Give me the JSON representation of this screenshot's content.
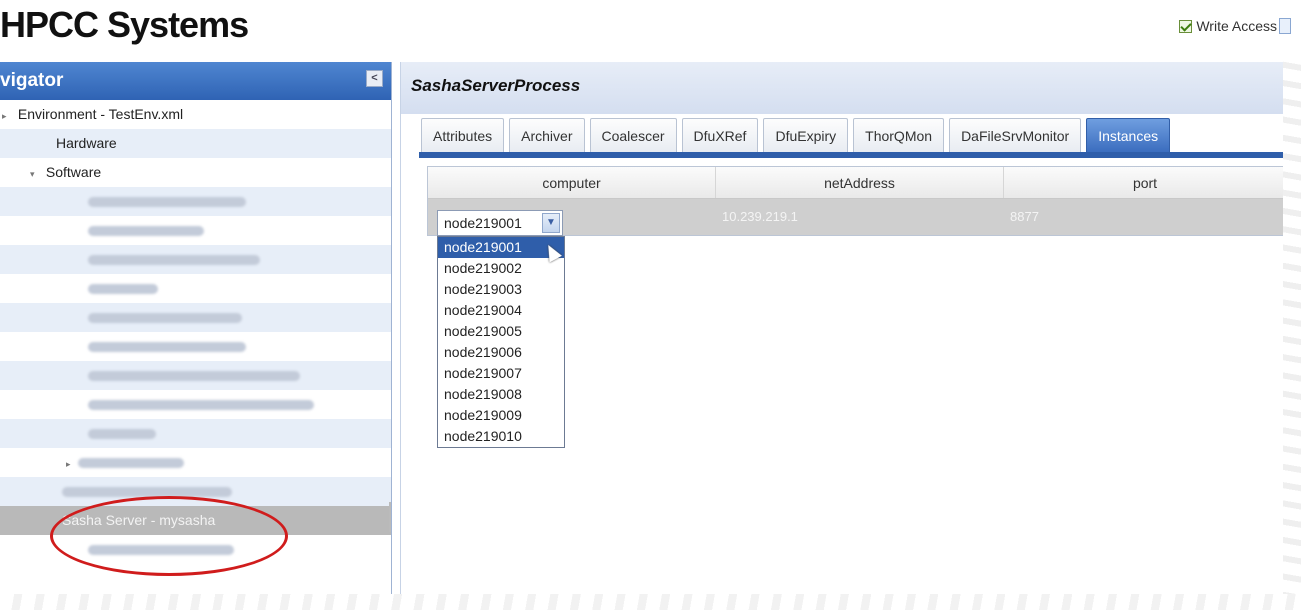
{
  "header": {
    "logo_text": "HPCC Systems",
    "write_access_label": "Write Access"
  },
  "navigator": {
    "title": "vigator",
    "collapse_glyph": "<",
    "items": [
      {
        "label": "Environment - TestEnv.xml",
        "indent": 0,
        "toggle": "▸"
      },
      {
        "label": "Hardware",
        "indent": 1,
        "toggle": ""
      },
      {
        "label": "Software",
        "indent": 1,
        "toggle": "▾"
      },
      {
        "label": "Sasha Server - mysasha",
        "indent": 2,
        "toggle": "",
        "selected": true
      }
    ]
  },
  "main": {
    "title": "SashaServerProcess",
    "tabs": [
      {
        "label": "Attributes"
      },
      {
        "label": "Archiver"
      },
      {
        "label": "Coalescer"
      },
      {
        "label": "DfuXRef"
      },
      {
        "label": "DfuExpiry"
      },
      {
        "label": "ThorQMon"
      },
      {
        "label": "DaFileSrvMonitor"
      },
      {
        "label": "Instances",
        "active": true
      }
    ],
    "grid": {
      "columns": [
        "computer",
        "netAddress",
        "port"
      ],
      "row": {
        "computer": "node219001",
        "netAddress": "10.239.219.1",
        "port": "8877"
      }
    },
    "dropdown": {
      "selected": "node219001",
      "options": [
        "node219001",
        "node219002",
        "node219003",
        "node219004",
        "node219005",
        "node219006",
        "node219007",
        "node219008",
        "node219009",
        "node219010"
      ]
    }
  },
  "colors": {
    "accent": "#2f5eaa",
    "annotation": "#d01c1c"
  }
}
